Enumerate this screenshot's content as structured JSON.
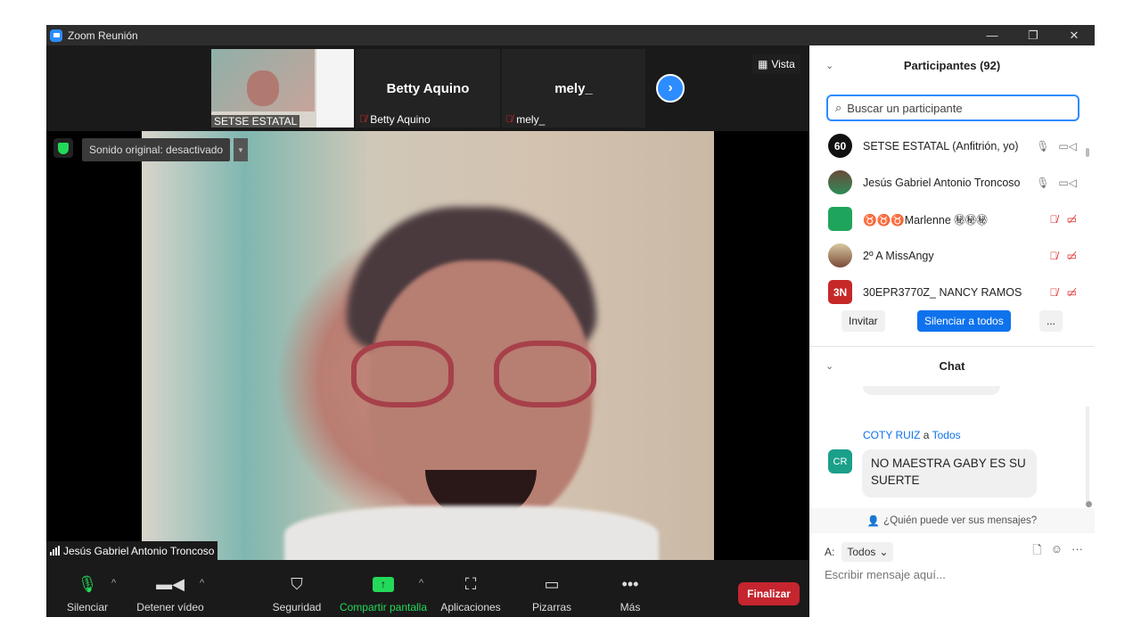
{
  "window": {
    "title": "Zoom Reunión",
    "controls": [
      "—",
      "❐",
      "✕"
    ]
  },
  "thumbnails": [
    {
      "name": "SETSE ESTATAL",
      "display_name": ""
    },
    {
      "name": "Betty Aquino",
      "display_name": "Betty Aquino"
    },
    {
      "name": "mely_",
      "display_name": "mely_"
    }
  ],
  "view_button": "Vista",
  "sound_notice": "Sonido original: desactivado",
  "active_speaker": "Jesús Gabriel Antonio Troncoso",
  "toolbar": {
    "mute": "Silenciar",
    "stop_video": "Detener vídeo",
    "security": "Seguridad",
    "share": "Compartir pantalla",
    "apps": "Aplicaciones",
    "whiteboards": "Pizarras",
    "more": "Más",
    "end": "Finalizar",
    "share_color": "#23d959",
    "end_color": "#c5252e"
  },
  "participants": {
    "header": "Participantes (92)",
    "search_placeholder": "Buscar un participante",
    "list": [
      {
        "avatar": "60",
        "name": "SETSE ESTATAL (Anfitrión, yo)",
        "muted": false
      },
      {
        "avatar": "",
        "name": "Jesús Gabriel Antonio Troncoso",
        "muted": false
      },
      {
        "avatar": "",
        "name": "♉♉♉Marlenne ㊙㊙㊙",
        "muted": true
      },
      {
        "avatar": "",
        "name": "2º A  MissAngy",
        "muted": true
      },
      {
        "avatar": "3N",
        "name": "30EPR3770Z_ NANCY RAMOS",
        "muted": true
      }
    ],
    "invite": "Invitar",
    "mute_all": "Silenciar a todos",
    "more": "..."
  },
  "chat": {
    "header": "Chat",
    "message": {
      "sender": "COTY RUIZ",
      "connector": "a",
      "recipient": "Todos",
      "initials": "CR",
      "text": "NO MAESTRA GABY ES SU SUERTE"
    },
    "who_can_see": "¿Quién puede ver sus mensajes?",
    "to_label": "A:",
    "to_value": "Todos",
    "compose_placeholder": "Escribir mensaje aquí..."
  }
}
